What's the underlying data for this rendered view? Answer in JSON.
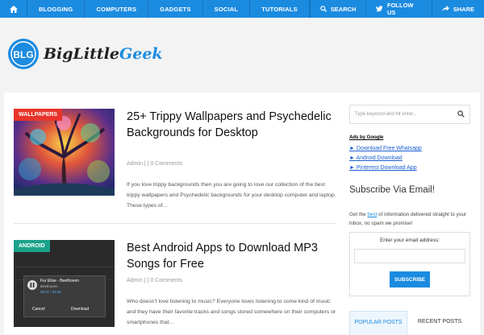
{
  "nav": {
    "items": [
      "BLOGGING",
      "COMPUTERS",
      "GADGETS",
      "SOCIAL",
      "TUTORIALS"
    ],
    "search_label": "SEARCH",
    "follow_label": "FOLLOW US",
    "share_label": "SHARE"
  },
  "logo": {
    "badge": "BLG",
    "text_a": "BigLittle",
    "text_b": "Geek"
  },
  "posts": [
    {
      "tag": "WALLPAPERS",
      "title": "25+ Trippy Wallpapers and Psychedelic Backgrounds for Desktop",
      "meta": "Admin | | 0 Comments",
      "excerpt": "If you love trippy backgrounds then you are going to love our collection of the best trippy wallpapers and Psychedelic backgrounds for your desktop computer and laptop. These types of..."
    },
    {
      "tag": "ANDROID",
      "title": "Best Android Apps to Download MP3 Songs for Free",
      "meta": "Admin | | 0 Comments",
      "excerpt": "Who doesn't love listening to music? Everyone loves listening to some kind of music and they have their favorite tracks and songs stored somewhere on their computers or smartphones that..."
    }
  ],
  "phone": {
    "song": "Fur Elise - Beethoven",
    "artist": "Beethoven",
    "time": "00:11 / 02:52",
    "cancel": "Cancel",
    "download": "Download"
  },
  "sidebar": {
    "search_placeholder": "Type keyword and hit enter...",
    "ads_title": "Ads by Google",
    "ads": [
      "► Download Free Whatsapp",
      "► Android Download",
      "► Pinterest Download App"
    ],
    "subscribe_heading": "Subscribe Via Email!",
    "sub_text_a": "Get the ",
    "sub_text_best": "best",
    "sub_text_b": " of information delivered straight to your inbox, no spam we promise!",
    "email_label": "Enter your email address:",
    "subscribe_button": "SUBSCRIBE",
    "tab_popular": "POPULAR POSTS",
    "tab_recent": "RECENT POSTS"
  },
  "colors": {
    "accent": "#1b8be0",
    "tag_wallpapers": "#e8342a",
    "tag_android": "#1aa38a"
  }
}
